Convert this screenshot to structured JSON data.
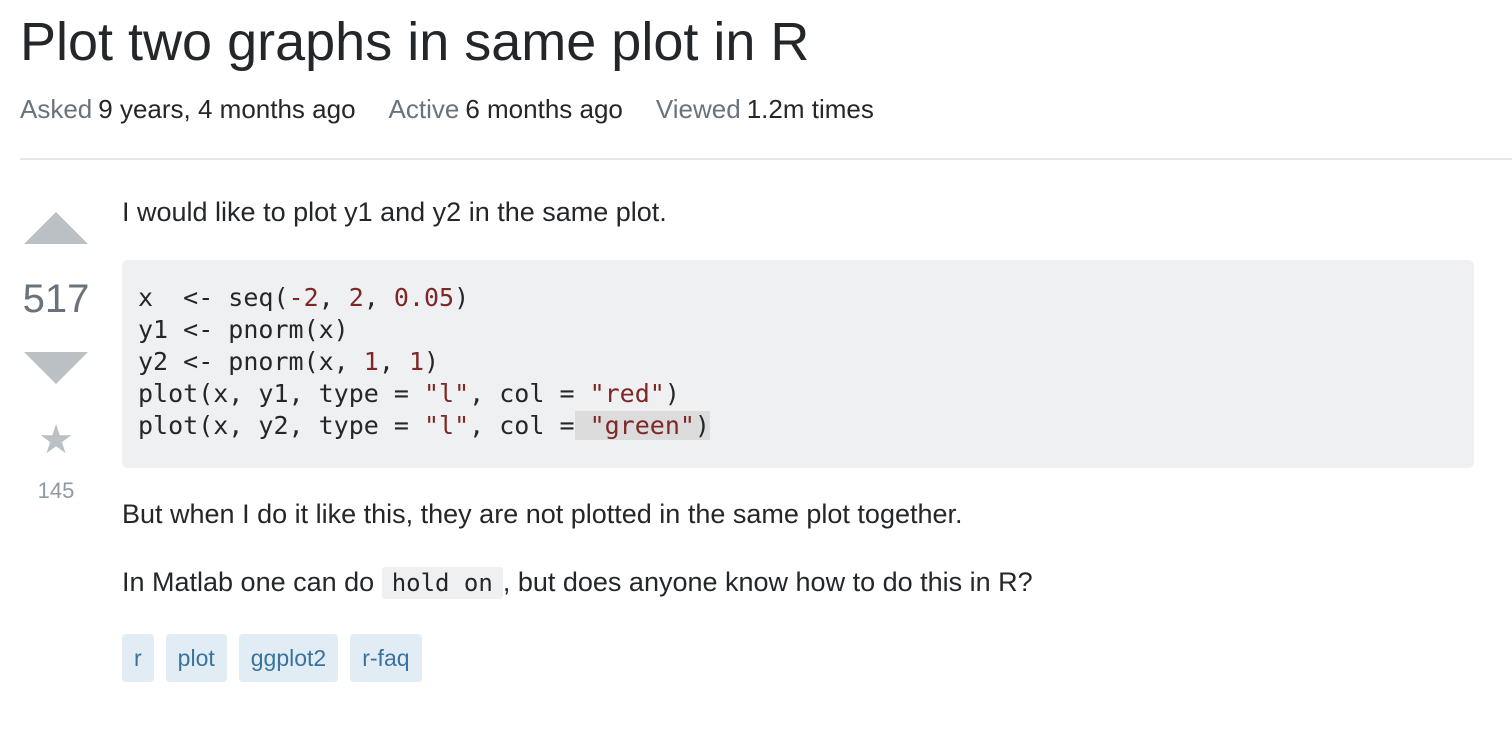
{
  "question": {
    "title": "Plot two graphs in same plot in R",
    "meta": [
      {
        "label": "Asked",
        "value": "9 years, 4 months ago"
      },
      {
        "label": "Active",
        "value": "6 months ago"
      },
      {
        "label": "Viewed",
        "value": "1.2m times"
      }
    ],
    "votes": "517",
    "favorites": "145",
    "body": {
      "intro": "I would like to plot y1 and y2 in the same plot.",
      "code": {
        "l1_a": "x  <- seq(",
        "l1_n1": "-2",
        "l1_sep1": ", ",
        "l1_n2": "2",
        "l1_sep2": ", ",
        "l1_n3": "0.05",
        "l1_end": ")",
        "l2": "y1 <- pnorm(x)",
        "l3_a": "y2 <- pnorm(x, ",
        "l3_n1": "1",
        "l3_sep": ", ",
        "l3_n2": "1",
        "l3_end": ")",
        "l4_a": "plot(x, y1, type = ",
        "l4_s1": "\"l\"",
        "l4_b": ", col = ",
        "l4_s2": "\"red\"",
        "l4_end": ")",
        "l5_a": "plot(x, y2, type = ",
        "l5_s1": "\"l\"",
        "l5_b": ", col =",
        "l5_sel_space": " ",
        "l5_s2": "\"green\"",
        "l5_end": ")"
      },
      "p2": "But when I do it like this, they are not plotted in the same plot together.",
      "p3_before": "In Matlab one can do ",
      "p3_code": "hold on",
      "p3_after": ", but does anyone know how to do this in R?"
    },
    "tags": [
      "r",
      "plot",
      "ggplot2",
      "r-faq"
    ]
  },
  "icons": {
    "upvote": "upvote-arrow-icon",
    "downvote": "downvote-arrow-icon",
    "favorite": "star-icon"
  },
  "colors": {
    "tag_bg": "#e1ecf4",
    "tag_text": "#39739d",
    "code_bg": "#eff0f1",
    "code_literal": "#7d2727",
    "vote_arrow": "#bbc0c4"
  }
}
